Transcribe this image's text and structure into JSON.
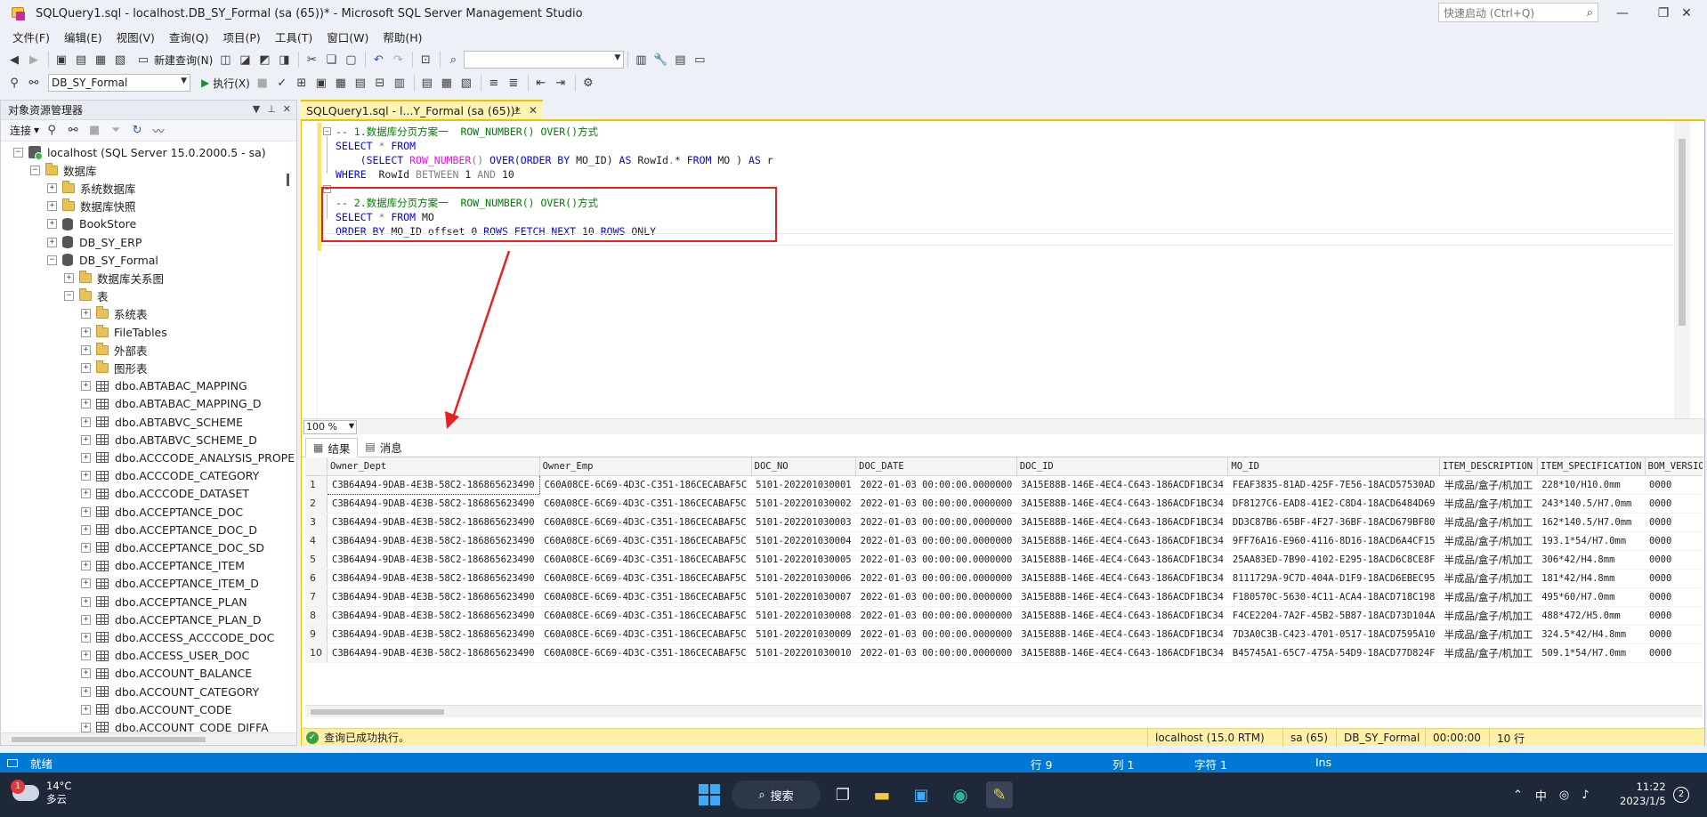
{
  "window": {
    "title": "SQLQuery1.sql - localhost.DB_SY_Formal (sa (65))* - Microsoft SQL Server Management Studio",
    "quick_launch_placeholder": "快速启动 (Ctrl+Q)"
  },
  "menu": [
    "文件(F)",
    "编辑(E)",
    "视图(V)",
    "查询(Q)",
    "项目(P)",
    "工具(T)",
    "窗口(W)",
    "帮助(H)"
  ],
  "toolbar1": {
    "new_query": "新建查询(N)"
  },
  "toolbar2": {
    "database": "DB_SY_Formal",
    "execute": "执行(X)"
  },
  "object_explorer": {
    "title": "对象资源管理器",
    "connect": "连接",
    "tree": [
      {
        "label": "localhost (SQL Server 15.0.2000.5 - sa)",
        "level": 0,
        "icon": "server",
        "toggle": "-"
      },
      {
        "label": "数据库",
        "level": 1,
        "icon": "folder",
        "toggle": "-"
      },
      {
        "label": "系统数据库",
        "level": 2,
        "icon": "folder",
        "toggle": "+"
      },
      {
        "label": "数据库快照",
        "level": 2,
        "icon": "folder",
        "toggle": "+"
      },
      {
        "label": "BookStore",
        "level": 2,
        "icon": "db",
        "toggle": "+"
      },
      {
        "label": "DB_SY_ERP",
        "level": 2,
        "icon": "db",
        "toggle": "+"
      },
      {
        "label": "DB_SY_Formal",
        "level": 2,
        "icon": "db",
        "toggle": "-"
      },
      {
        "label": "数据库关系图",
        "level": 3,
        "icon": "folder",
        "toggle": "+"
      },
      {
        "label": "表",
        "level": 3,
        "icon": "folder",
        "toggle": "-"
      },
      {
        "label": "系统表",
        "level": 4,
        "icon": "folder",
        "toggle": "+"
      },
      {
        "label": "FileTables",
        "level": 4,
        "icon": "folder",
        "toggle": "+"
      },
      {
        "label": "外部表",
        "level": 4,
        "icon": "folder",
        "toggle": "+"
      },
      {
        "label": "图形表",
        "level": 4,
        "icon": "folder",
        "toggle": "+"
      },
      {
        "label": "dbo.ABTABAC_MAPPING",
        "level": 4,
        "icon": "table",
        "toggle": "+"
      },
      {
        "label": "dbo.ABTABAC_MAPPING_D",
        "level": 4,
        "icon": "table",
        "toggle": "+"
      },
      {
        "label": "dbo.ABTABVC_SCHEME",
        "level": 4,
        "icon": "table",
        "toggle": "+"
      },
      {
        "label": "dbo.ABTABVC_SCHEME_D",
        "level": 4,
        "icon": "table",
        "toggle": "+"
      },
      {
        "label": "dbo.ACCCODE_ANALYSIS_PROPE",
        "level": 4,
        "icon": "table",
        "toggle": "+"
      },
      {
        "label": "dbo.ACCCODE_CATEGORY",
        "level": 4,
        "icon": "table",
        "toggle": "+"
      },
      {
        "label": "dbo.ACCCODE_DATASET",
        "level": 4,
        "icon": "table",
        "toggle": "+"
      },
      {
        "label": "dbo.ACCEPTANCE_DOC",
        "level": 4,
        "icon": "table",
        "toggle": "+"
      },
      {
        "label": "dbo.ACCEPTANCE_DOC_D",
        "level": 4,
        "icon": "table",
        "toggle": "+"
      },
      {
        "label": "dbo.ACCEPTANCE_DOC_SD",
        "level": 4,
        "icon": "table",
        "toggle": "+"
      },
      {
        "label": "dbo.ACCEPTANCE_ITEM",
        "level": 4,
        "icon": "table",
        "toggle": "+"
      },
      {
        "label": "dbo.ACCEPTANCE_ITEM_D",
        "level": 4,
        "icon": "table",
        "toggle": "+"
      },
      {
        "label": "dbo.ACCEPTANCE_PLAN",
        "level": 4,
        "icon": "table",
        "toggle": "+"
      },
      {
        "label": "dbo.ACCEPTANCE_PLAN_D",
        "level": 4,
        "icon": "table",
        "toggle": "+"
      },
      {
        "label": "dbo.ACCESS_ACCCODE_DOC",
        "level": 4,
        "icon": "table",
        "toggle": "+"
      },
      {
        "label": "dbo.ACCESS_USER_DOC",
        "level": 4,
        "icon": "table",
        "toggle": "+"
      },
      {
        "label": "dbo.ACCOUNT_BALANCE",
        "level": 4,
        "icon": "table",
        "toggle": "+"
      },
      {
        "label": "dbo.ACCOUNT_CATEGORY",
        "level": 4,
        "icon": "table",
        "toggle": "+"
      },
      {
        "label": "dbo.ACCOUNT_CODE",
        "level": 4,
        "icon": "table",
        "toggle": "+"
      },
      {
        "label": "dbo.ACCOUNT_CODE_DIFFA",
        "level": 4,
        "icon": "table",
        "toggle": "+"
      }
    ]
  },
  "editor": {
    "tab_title": "SQLQuery1.sql - l...Y_Formal (sa (65))*",
    "zoom": "100 %",
    "lines": [
      {
        "comment": "-- 1.数据库分页方案一  ROW_NUMBER() OVER()方式"
      },
      {
        "kw1": "SELECT",
        "gr1": " * ",
        "kw2": "FROM"
      },
      {
        "pre": "    (",
        "kw1": "SELECT",
        "fn1": " ROW_NUMBER",
        "gr1": "() ",
        "kw2": "OVER",
        "plain1": "(",
        "kw3": "ORDER BY",
        "plain2": " MO_ID) ",
        "kw4": "AS",
        "plain3": " RowId",
        "gr2": ".",
        "plain4": "* ",
        "kw5": "FROM",
        "plain5": " MO ) ",
        "kw6": "AS",
        "plain6": " r"
      },
      {
        "kw1": "WHERE",
        "plain1": "  RowId ",
        "gr1": "BETWEEN",
        "plain2": " 1 ",
        "gr2": "AND",
        "plain3": " 10"
      },
      {
        "comment": "-- 2.数据库分页方案一  ROW_NUMBER() OVER()方式"
      },
      {
        "kw1": "SELECT",
        "gr1": " * ",
        "kw2": "FROM",
        "plain1": " MO"
      },
      {
        "kw1": "ORDER BY",
        "plain1": " MO_ID offset 0 ",
        "kw2": "ROWS FETCH NEXT",
        "plain2": " 10 ",
        "kw3": "ROWS",
        "plain3": " ONLY"
      }
    ]
  },
  "results": {
    "tab_results": "结果",
    "tab_messages": "消息",
    "columns": [
      "Owner_Dept",
      "Owner_Emp",
      "DOC_NO",
      "DOC_DATE",
      "DOC_ID",
      "MO_ID",
      "ITEM_DESCRIPTION",
      "ITEM_SPECIFICATION",
      "BOM_VERSIO"
    ],
    "rows": [
      [
        "1",
        "C3B64A94-9DAB-4E3B-58C2-186865623490",
        "C60A08CE-6C69-4D3C-C351-186CECABAF5C",
        "5101-202201030001",
        "2022-01-03 00:00:00.0000000",
        "3A15E88B-146E-4EC4-C643-186ACDF1BC34",
        "FEAF3835-81AD-425F-7E56-18ACD57530AD",
        "半成品/盒子/机加工",
        "228*10/H10.0mm",
        "0000"
      ],
      [
        "2",
        "C3B64A94-9DAB-4E3B-58C2-186865623490",
        "C60A08CE-6C69-4D3C-C351-186CECABAF5C",
        "5101-202201030002",
        "2022-01-03 00:00:00.0000000",
        "3A15E88B-146E-4EC4-C643-186ACDF1BC34",
        "DF8127C6-EAD8-41E2-C8D4-18ACD6484D69",
        "半成品/盒子/机加工",
        "243*140.5/H7.0mm",
        "0000"
      ],
      [
        "3",
        "C3B64A94-9DAB-4E3B-58C2-186865623490",
        "C60A08CE-6C69-4D3C-C351-186CECABAF5C",
        "5101-202201030003",
        "2022-01-03 00:00:00.0000000",
        "3A15E88B-146E-4EC4-C643-186ACDF1BC34",
        "DD3C87B6-65BF-4F27-36BF-18ACD679BF80",
        "半成品/盒子/机加工",
        "162*140.5/H7.0mm",
        "0000"
      ],
      [
        "4",
        "C3B64A94-9DAB-4E3B-58C2-186865623490",
        "C60A08CE-6C69-4D3C-C351-186CECABAF5C",
        "5101-202201030004",
        "2022-01-03 00:00:00.0000000",
        "3A15E88B-146E-4EC4-C643-186ACDF1BC34",
        "9FF76A16-E960-4116-8D16-18ACD6A4CF15",
        "半成品/盒子/机加工",
        "193.1*54/H7.0mm",
        "0000"
      ],
      [
        "5",
        "C3B64A94-9DAB-4E3B-58C2-186865623490",
        "C60A08CE-6C69-4D3C-C351-186CECABAF5C",
        "5101-202201030005",
        "2022-01-03 00:00:00.0000000",
        "3A15E88B-146E-4EC4-C643-186ACDF1BC34",
        "25AA83ED-7B90-4102-E295-18ACD6C8CE8F",
        "半成品/盒子/机加工",
        "306*42/H4.8mm",
        "0000"
      ],
      [
        "6",
        "C3B64A94-9DAB-4E3B-58C2-186865623490",
        "C60A08CE-6C69-4D3C-C351-186CECABAF5C",
        "5101-202201030006",
        "2022-01-03 00:00:00.0000000",
        "3A15E88B-146E-4EC4-C643-186ACDF1BC34",
        "8111729A-9C7D-404A-D1F9-18ACD6EBEC95",
        "半成品/盒子/机加工",
        "181*42/H4.8mm",
        "0000"
      ],
      [
        "7",
        "C3B64A94-9DAB-4E3B-58C2-186865623490",
        "C60A08CE-6C69-4D3C-C351-186CECABAF5C",
        "5101-202201030007",
        "2022-01-03 00:00:00.0000000",
        "3A15E88B-146E-4EC4-C643-186ACDF1BC34",
        "F180570C-5630-4C11-ACA4-18ACD718C198",
        "半成品/盒子/机加工",
        "495*60/H7.0mm",
        "0000"
      ],
      [
        "8",
        "C3B64A94-9DAB-4E3B-58C2-186865623490",
        "C60A08CE-6C69-4D3C-C351-186CECABAF5C",
        "5101-202201030008",
        "2022-01-03 00:00:00.0000000",
        "3A15E88B-146E-4EC4-C643-186ACDF1BC34",
        "F4CE2204-7A2F-45B2-5B87-18ACD73D104A",
        "半成品/盒子/机加工",
        "488*472/H5.0mm",
        "0000"
      ],
      [
        "9",
        "C3B64A94-9DAB-4E3B-58C2-186865623490",
        "C60A08CE-6C69-4D3C-C351-186CECABAF5C",
        "5101-202201030009",
        "2022-01-03 00:00:00.0000000",
        "3A15E88B-146E-4EC4-C643-186ACDF1BC34",
        "7D3A0C3B-C423-4701-0517-18ACD7595A10",
        "半成品/盒子/机加工",
        "324.5*42/H4.8mm",
        "0000"
      ],
      [
        "10",
        "C3B64A94-9DAB-4E3B-58C2-186865623490",
        "C60A08CE-6C69-4D3C-C351-186CECABAF5C",
        "5101-202201030010",
        "2022-01-03 00:00:00.0000000",
        "3A15E88B-146E-4EC4-C643-186ACDF1BC34",
        "B45745A1-65C7-475A-54D9-18ACD77D824F",
        "半成品/盒子/机加工",
        "509.1*54/H7.0mm",
        "0000"
      ]
    ]
  },
  "query_status": {
    "message": "查询已成功执行。",
    "server": "localhost (15.0 RTM)",
    "user": "sa (65)",
    "database": "DB_SY_Formal",
    "elapsed": "00:00:00",
    "rows": "10 行"
  },
  "statusbar": {
    "ready": "就绪",
    "line": "行 9",
    "col": "列 1",
    "char": "字符 1",
    "mode": "Ins"
  },
  "taskbar": {
    "weather_badge": "1",
    "temp": "14°C",
    "condition": "多云",
    "search": "搜索",
    "ime": "中",
    "time": "11:22",
    "date": "2023/1/5",
    "notifications": "2"
  },
  "colors": {
    "accent": "#0078d4",
    "keyword": "#0000ff",
    "function": "#ff00ff",
    "comment": "#008000",
    "highlight_box": "#ea2020",
    "tab_active": "#fef3b3"
  }
}
